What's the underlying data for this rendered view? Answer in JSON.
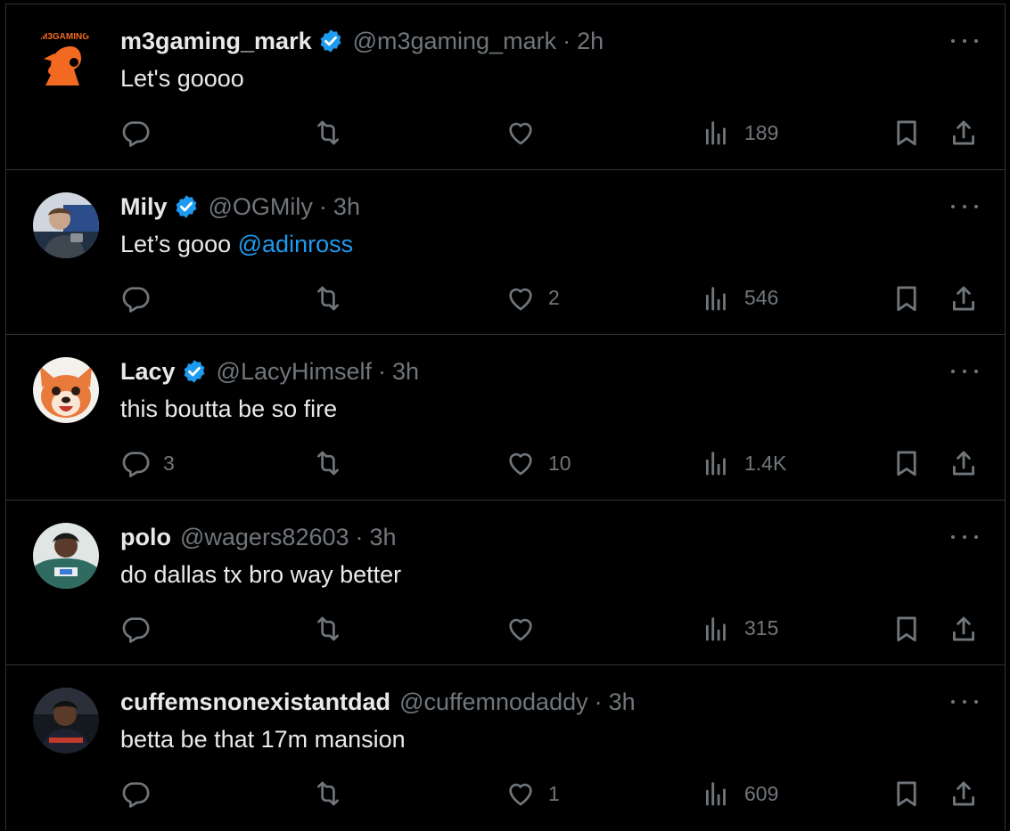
{
  "tweets": [
    {
      "name": "m3gaming_mark",
      "verified": true,
      "handle": "@m3gaming_mark",
      "time": "2h",
      "text": "Let's goooo",
      "mention": "",
      "avatar_logo_text": "M3GAMING",
      "replies": "",
      "retweets": "",
      "likes": "",
      "views": "189"
    },
    {
      "name": "Mily",
      "verified": true,
      "handle": "@OGMily",
      "time": "3h",
      "text": "Let’s gooo ",
      "mention": "@adinross",
      "replies": "",
      "retweets": "",
      "likes": "2",
      "views": "546"
    },
    {
      "name": "Lacy",
      "verified": true,
      "handle": "@LacyHimself",
      "time": "3h",
      "text": "this boutta be so fire",
      "mention": "",
      "replies": "3",
      "retweets": "",
      "likes": "10",
      "views": "1.4K"
    },
    {
      "name": "polo",
      "verified": false,
      "handle": "@wagers82603",
      "time": "3h",
      "text": "do dallas tx bro way better",
      "mention": "",
      "replies": "",
      "retweets": "",
      "likes": "",
      "views": "315"
    },
    {
      "name": "cuffemsnonexistantdad",
      "verified": false,
      "handle": "@cuffemnodaddy",
      "time": "3h",
      "text": "betta be that 17m mansion",
      "mention": "",
      "replies": "",
      "retweets": "",
      "likes": "1",
      "views": "609"
    }
  ],
  "separator": "·",
  "colors": {
    "background": "#000000",
    "text": "#e7e9ea",
    "muted": "#71767b",
    "accent": "#1d9bf0",
    "border": "#2f3336"
  },
  "icons": [
    "reply-icon",
    "retweet-icon",
    "like-icon",
    "views-icon",
    "bookmark-icon",
    "share-icon",
    "more-icon",
    "verified-badge-icon"
  ]
}
